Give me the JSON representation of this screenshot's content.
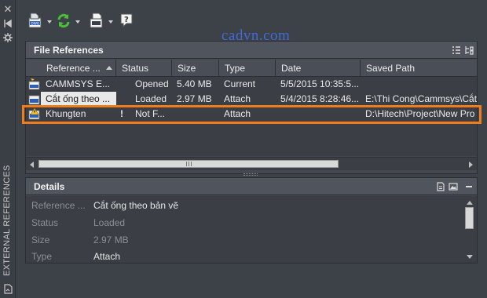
{
  "side_bar": {
    "close_icon": "close-icon",
    "pin_icon": "autohide-icon",
    "settings_icon": "properties-icon",
    "title": "EXTERNAL REFERENCES",
    "attach_icon": "attach-dwg-icon"
  },
  "toolbar": {
    "buttons": [
      "attach-dwg-icon",
      "refresh-icon",
      "change-path-icon",
      "help-icon"
    ]
  },
  "watermark": "cadvn.com",
  "file_references": {
    "title": "File References",
    "columns": [
      "Reference ...",
      "Status",
      "Size",
      "Type",
      "Date",
      "Saved Path"
    ],
    "rows": [
      {
        "name": "CAMMSYS E...",
        "status": "Opened",
        "size": "5.40 MB",
        "type": "Current",
        "date": "5/5/2015 10:35:5...",
        "saved_path": "",
        "icon": "current-drawing-icon"
      },
      {
        "name": "Cắt ống theo ...",
        "status": "Loaded",
        "size": "2.97 MB",
        "type": "Attach",
        "date": "5/4/2015 8:28:46...",
        "saved_path": "E:\\Thi Cong\\Cammsys\\Cắt",
        "icon": "dwg-file-icon"
      },
      {
        "name": "Khungten",
        "status_flag": "!",
        "status": "Not F...",
        "size": "",
        "type": "Attach",
        "date": "",
        "saved_path": "D:\\Hitech\\Project\\New Pro",
        "icon": "dwg-warning-icon"
      }
    ]
  },
  "details": {
    "title": "Details",
    "fields": [
      {
        "label": "Reference ...",
        "value": "Cắt ống theo bản vẽ",
        "dim": false
      },
      {
        "label": "Status",
        "value": "Loaded",
        "dim": true
      },
      {
        "label": "Size",
        "value": "2.97 MB",
        "dim": true
      },
      {
        "label": "Type",
        "value": "Attach",
        "dim": false
      }
    ]
  },
  "colors": {
    "highlight": "#f07d19",
    "watermark": "#3f6ad8",
    "panel_bg": "#3b3f45"
  }
}
